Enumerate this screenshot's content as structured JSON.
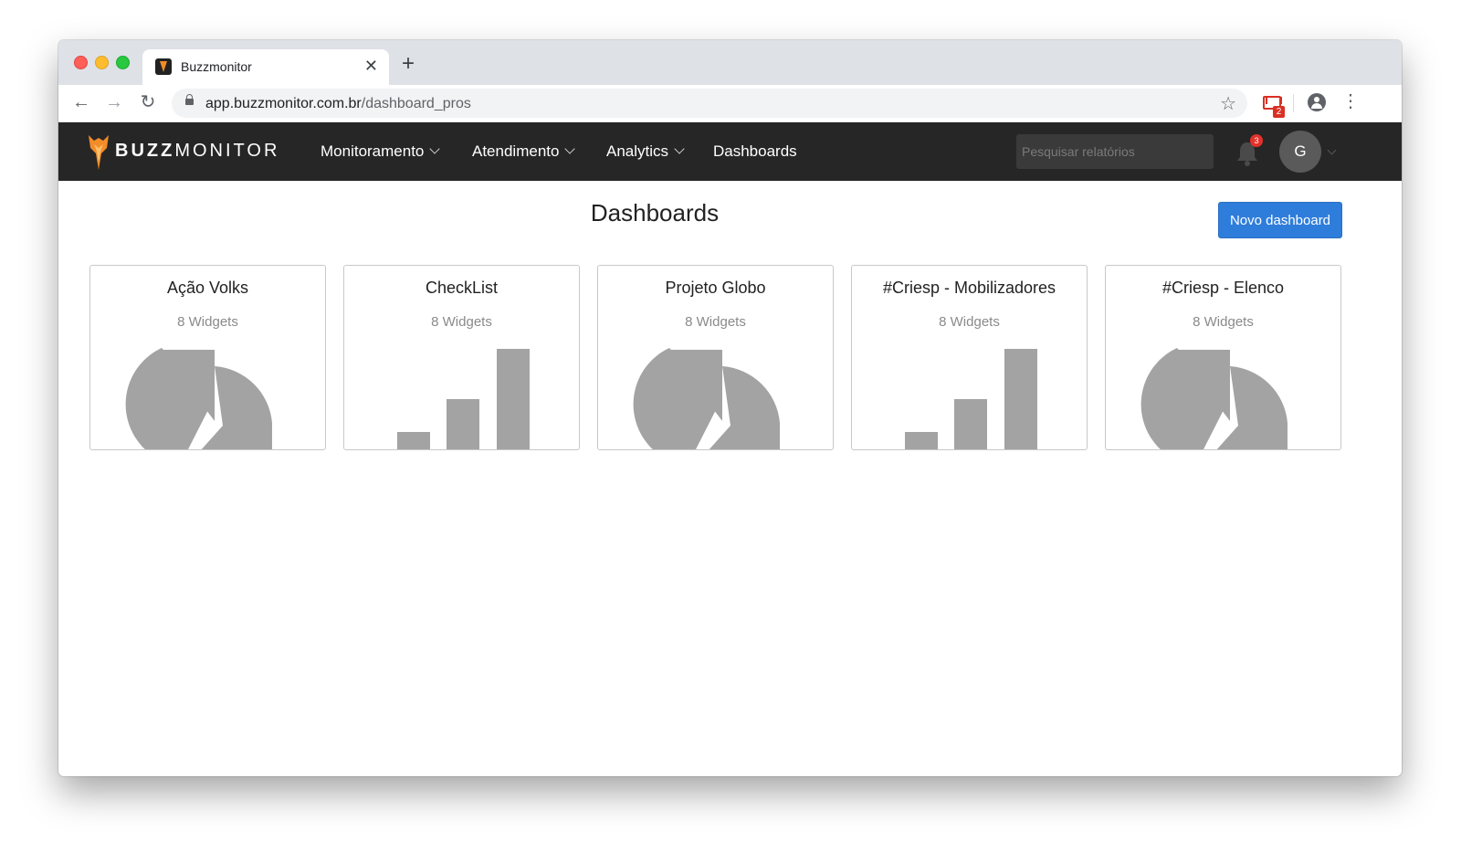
{
  "browser": {
    "tab_title": "Buzzmonitor",
    "url_host": "app.buzzmonitor.com.br",
    "url_path": "/dashboard_pros",
    "gmail_badge": "2"
  },
  "header": {
    "logo_bold": "BUZZ",
    "logo_light": "MONITOR",
    "nav": [
      {
        "label": "Monitoramento",
        "has_dropdown": true
      },
      {
        "label": "Atendimento",
        "has_dropdown": true
      },
      {
        "label": "Analytics",
        "has_dropdown": true
      },
      {
        "label": "Dashboards",
        "has_dropdown": false
      }
    ],
    "search_placeholder": "Pesquisar relatórios",
    "notification_count": "3",
    "avatar_initial": "G"
  },
  "page": {
    "title": "Dashboards",
    "new_button": "Novo dashboard"
  },
  "dashboards": [
    {
      "name": "Ação Volks",
      "widgets": "8 Widgets",
      "icon": "pie-chart-icon"
    },
    {
      "name": "CheckList",
      "widgets": "8 Widgets",
      "icon": "bar-chart-icon"
    },
    {
      "name": "Projeto Globo",
      "widgets": "8 Widgets",
      "icon": "pie-chart-icon"
    },
    {
      "name": "#Criesp - Mobilizadores",
      "widgets": "8 Widgets",
      "icon": "bar-chart-icon"
    },
    {
      "name": "#Criesp - Elenco",
      "widgets": "8 Widgets",
      "icon": "pie-chart-icon"
    }
  ],
  "colors": {
    "header_bg": "#262626",
    "primary_button": "#2f7ddb",
    "placeholder_graphic": "#a3a3a3",
    "notification_badge": "#e3312b"
  }
}
